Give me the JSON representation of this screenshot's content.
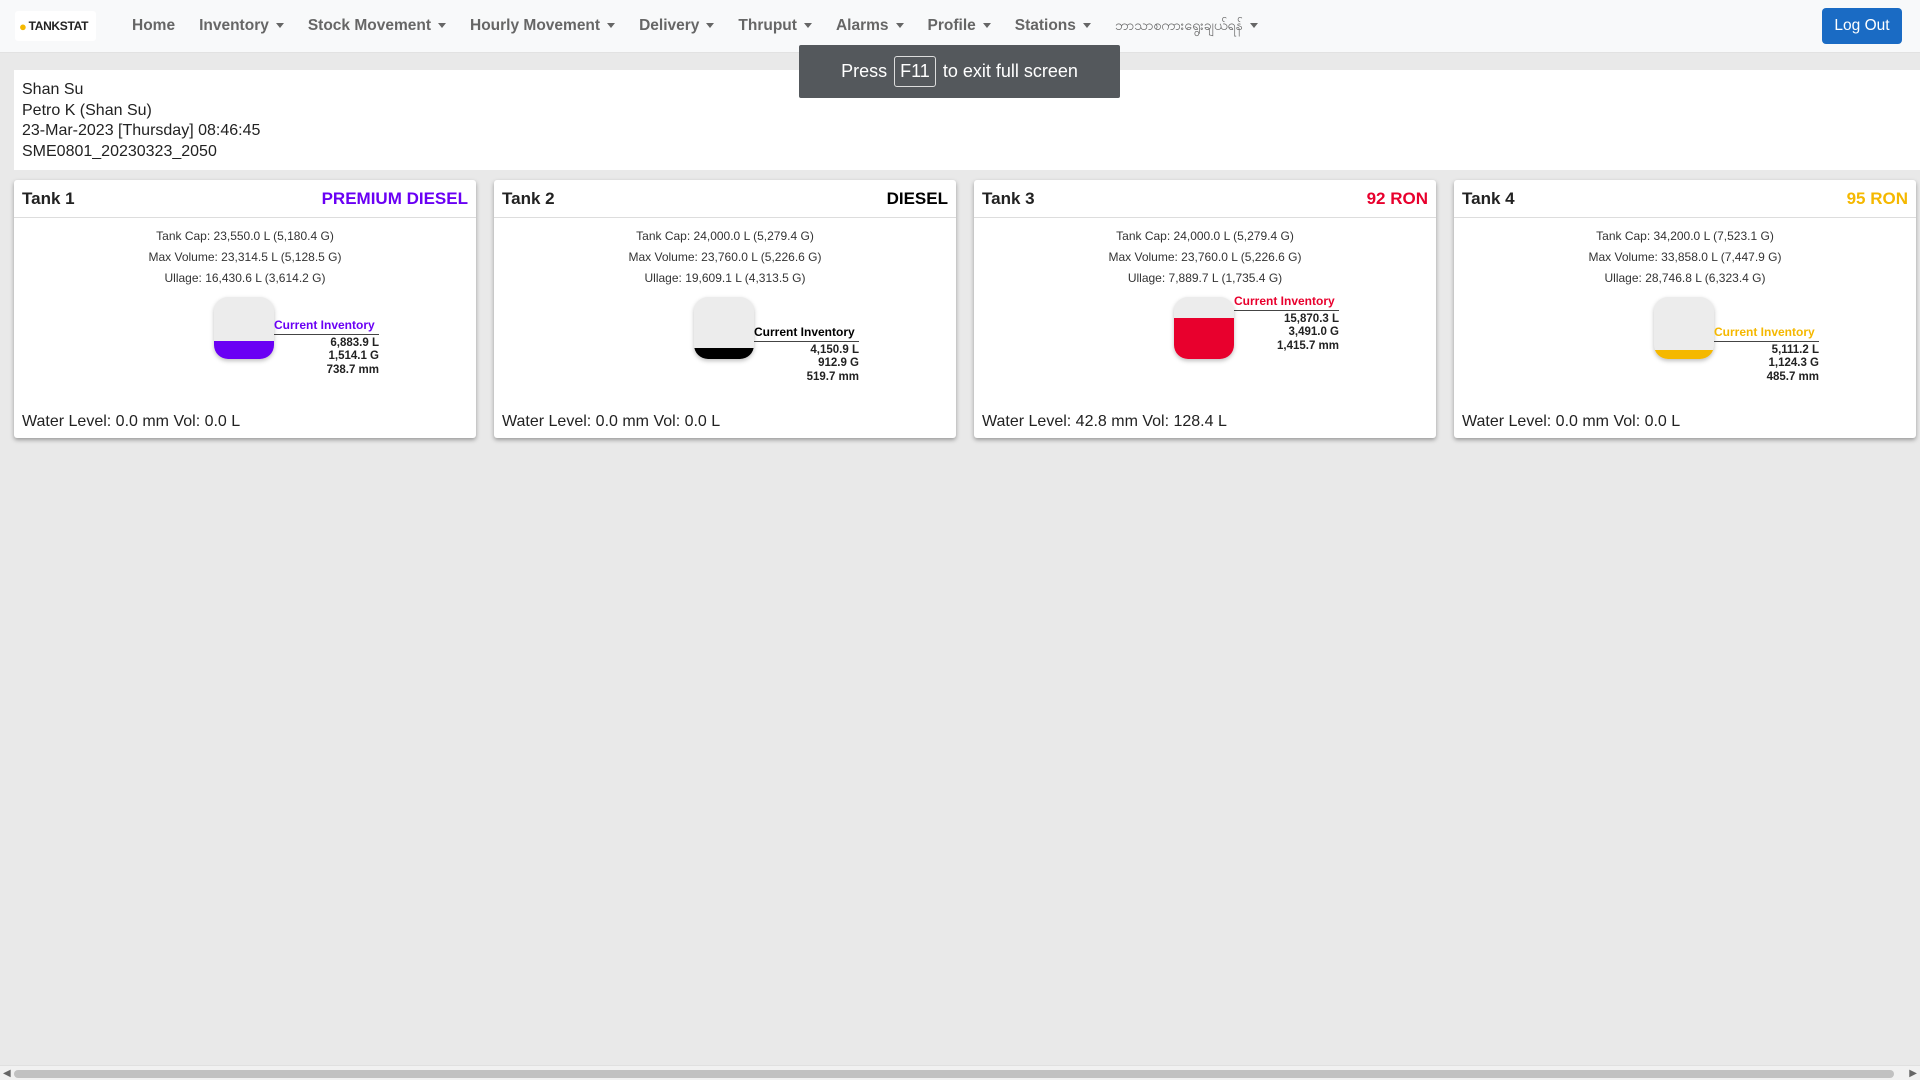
{
  "brand": {
    "name": "TANKSTAT",
    "icon": "fuel-drop-icon"
  },
  "nav": {
    "home": "Home",
    "inventory": "Inventory",
    "stock_movement": "Stock Movement",
    "hourly_movement": "Hourly Movement",
    "delivery": "Delivery",
    "thruput": "Thruput",
    "alarms": "Alarms",
    "profile": "Profile",
    "stations": "Stations",
    "language": "ဘာသာစကားရွေးချယ်ရန်"
  },
  "logout_label": "Log Out",
  "fullscreen_toast": {
    "press": "Press",
    "key": "F11",
    "suffix": "to exit full screen"
  },
  "info": {
    "line1": "Shan Su",
    "line2": "Petro K (Shan Su)",
    "line3": "23-Mar-2023 [Thursday] 08:46:45",
    "line4": "SME0801_20230323_2050"
  },
  "colors": {
    "premium_diesel": "#6a00f4",
    "diesel": "#000000",
    "ron92": "#e8002d",
    "ron95": "#f5b800",
    "logout_bg": "#1a6bc4"
  },
  "tanks": [
    {
      "name": "Tank 1",
      "product": "PREMIUM DIESEL",
      "cap": "Tank Cap: 23,550.0 L (5,180.4 G)",
      "max": "Max Volume: 23,314.5 L (5,128.5 G)",
      "ullage": "Ullage: 16,430.6 L (3,614.2 G)",
      "inv_label": "Current Inventory",
      "inv_l": "6,883.9 L",
      "inv_g": "1,514.1 G",
      "inv_mm": "738.7 mm",
      "fill_fraction": 0.29,
      "water": "Water Level: 0.0 mm Vol: 0.0 L"
    },
    {
      "name": "Tank 2",
      "product": "DIESEL",
      "cap": "Tank Cap: 24,000.0 L (5,279.4 G)",
      "max": "Max Volume: 23,760.0 L (5,226.6 G)",
      "ullage": "Ullage: 19,609.1 L (4,313.5 G)",
      "inv_label": "Current Inventory",
      "inv_l": "4,150.9 L",
      "inv_g": "912.9 G",
      "inv_mm": "519.7 mm",
      "fill_fraction": 0.17,
      "water": "Water Level: 0.0 mm Vol: 0.0 L"
    },
    {
      "name": "Tank 3",
      "product": "92 RON",
      "cap": "Tank Cap: 24,000.0 L (5,279.4 G)",
      "max": "Max Volume: 23,760.0 L (5,226.6 G)",
      "ullage": "Ullage: 7,889.7 L (1,735.4 G)",
      "inv_label": "Current Inventory",
      "inv_l": "15,870.3 L",
      "inv_g": "3,491.0 G",
      "inv_mm": "1,415.7 mm",
      "fill_fraction": 0.66,
      "water": "Water Level: 42.8 mm Vol: 128.4 L"
    },
    {
      "name": "Tank 4",
      "product": "95 RON",
      "cap": "Tank Cap: 34,200.0 L (7,523.1 G)",
      "max": "Max Volume: 33,858.0 L (7,447.9 G)",
      "ullage": "Ullage: 28,746.8 L (6,323.4 G)",
      "inv_label": "Current Inventory",
      "inv_l": "5,111.2 L",
      "inv_g": "1,124.3 G",
      "inv_mm": "485.7 mm",
      "fill_fraction": 0.15,
      "water": "Water Level: 0.0 mm Vol: 0.0 L"
    }
  ]
}
